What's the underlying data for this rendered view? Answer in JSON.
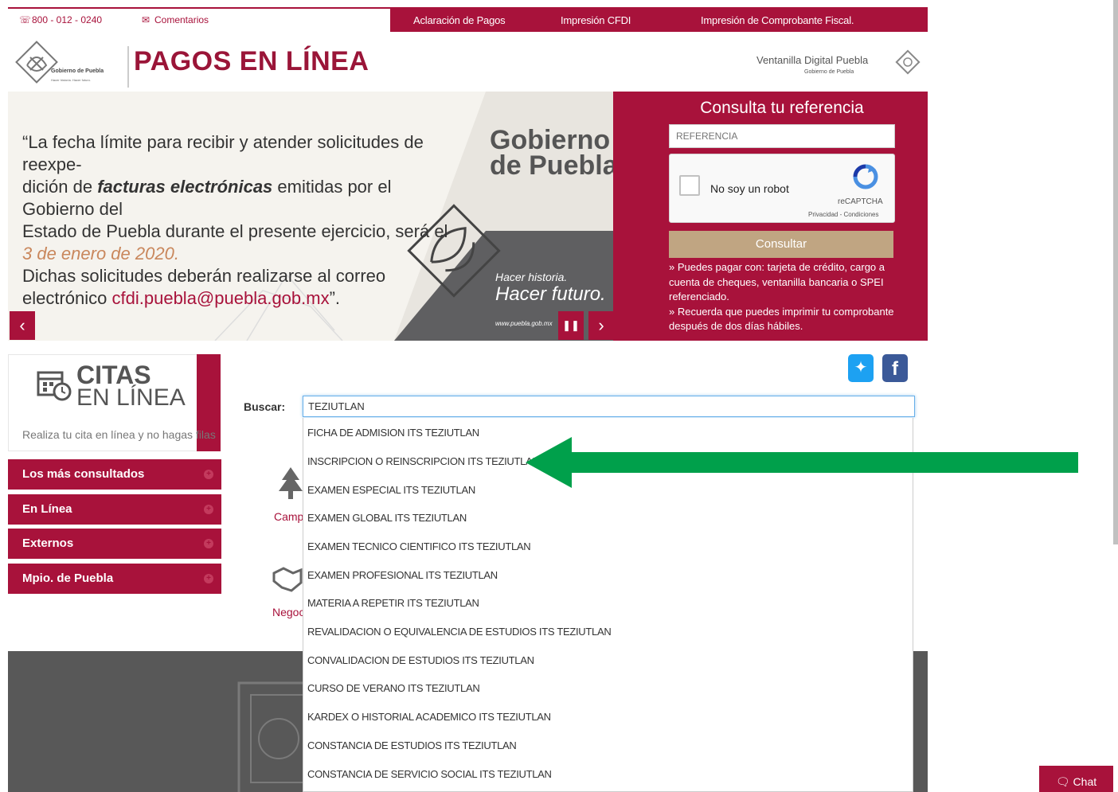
{
  "topbar": {
    "phone": "800 - 012 - 0240",
    "comments": "Comentarios",
    "links": [
      "Aclaración de Pagos",
      "Impresión CFDI",
      "Impresión de Comprobante Fiscal."
    ]
  },
  "header": {
    "logo_text": "Gobierno de Puebla",
    "logo_sub": "Hacer historia. Hacer futuro.",
    "title": "PAGOS EN LÍNEA",
    "ventanilla": "Ventanilla Digital Puebla",
    "ventanilla_sub": "Gobierno de Puebla"
  },
  "banner": {
    "quote_1": "“La fecha límite para recibir y atender solicitudes de reexpe-",
    "quote_2a": "dición de ",
    "quote_2b": "facturas electrónicas",
    "quote_2c": " emitidas por el Gobierno del",
    "quote_3": "Estado de Puebla durante el presente ejercicio, será el",
    "quote_4": "3 de enero de 2020.",
    "quote_5": "Dichas solicitudes deberán realizarse al correo",
    "quote_6a": "electrónico ",
    "quote_6b": "cfdi.puebla@puebla.gob.mx",
    "quote_6c": "”.",
    "gob_1": "Gobierno",
    "gob_2": "de Puebla",
    "hacer_1": "Hacer historia.",
    "hacer_2": "Hacer futuro.",
    "www": "www.puebla.gob.mx",
    "prev": "‹",
    "pause": "❚❚",
    "next": "›"
  },
  "consulta": {
    "title": "Consulta tu referencia",
    "placeholder": "REFERENCIA",
    "captcha_label": "No soy un robot",
    "captcha_brand": "reCAPTCHA",
    "captcha_privacy": "Privacidad - Condiciones",
    "button": "Consultar",
    "info_1": "» Puedes pagar con: tarjeta de crédito, cargo a cuenta de cheques, ventanilla bancaria o SPEI referenciado.",
    "info_2": "» Recuerda que puedes imprimir tu comprobante después de dos días hábiles."
  },
  "citas": {
    "title": "CITAS",
    "subtitle": "EN LÍNEA",
    "desc": "Realiza tu cita en línea y no hagas filas"
  },
  "menu": [
    "Los más consultados",
    "En Línea",
    "Externos",
    "Mpio. de Puebla"
  ],
  "search": {
    "label": "Buscar:",
    "value": "TEZIUTLAN"
  },
  "suggestions": [
    "FICHA DE ADMISION ITS TEZIUTLAN",
    "INSCRIPCION O REINSCRIPCION ITS TEZIUTLAN",
    "EXAMEN ESPECIAL ITS TEZIUTLAN",
    "EXAMEN GLOBAL ITS TEZIUTLAN",
    "EXAMEN TECNICO CIENTIFICO ITS TEZIUTLAN",
    "EXAMEN PROFESIONAL ITS TEZIUTLAN",
    "MATERIA A REPETIR ITS TEZIUTLAN",
    "REVALIDACION O EQUIVALENCIA DE ESTUDIOS ITS TEZIUTLAN",
    "CONVALIDACION DE ESTUDIOS ITS TEZIUTLAN",
    "CURSO DE VERANO ITS TEZIUTLAN",
    "KARDEX O HISTORIAL ACADEMICO ITS TEZIUTLAN",
    "CONSTANCIA DE ESTUDIOS ITS TEZIUTLAN",
    "CONSTANCIA DE SERVICIO SOCIAL ITS TEZIUTLAN"
  ],
  "side_labels": [
    "Camp",
    "Negoc"
  ],
  "chat": "Chat",
  "colors": {
    "brand": "#a8123b",
    "arrow": "#00a04b",
    "button": "#c0a582"
  }
}
